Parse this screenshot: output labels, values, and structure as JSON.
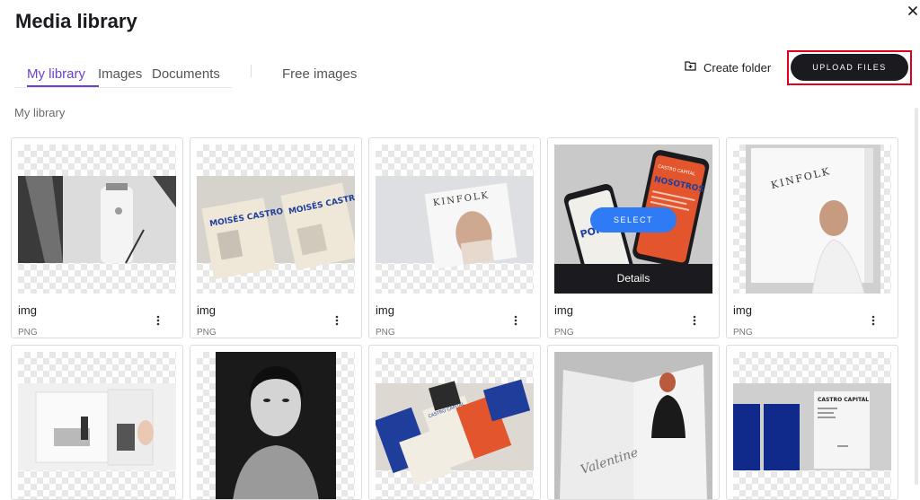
{
  "modal": {
    "title": "Media library"
  },
  "tabs": [
    {
      "label": "My library",
      "active": true
    },
    {
      "label": "Images",
      "active": false
    },
    {
      "label": "Documents",
      "active": false
    }
  ],
  "free_images_tab": "Free images",
  "toolbar": {
    "create_folder": "Create folder",
    "upload": "UPLOAD FILES"
  },
  "breadcrumb": "My library",
  "hover_actions": {
    "select": "SELECT",
    "details": "Details"
  },
  "accent_color": "#6b3fd1",
  "files": [
    {
      "name": "img",
      "type": "PNG"
    },
    {
      "name": "img",
      "type": "PNG"
    },
    {
      "name": "img",
      "type": "PNG"
    },
    {
      "name": "img",
      "type": "PNG"
    },
    {
      "name": "img",
      "type": "PNG"
    }
  ],
  "thumbnails": {
    "poster_text": "MOISÉS CASTRO",
    "magazine_text": "KINFOLK",
    "app_brand": "CASTRO CAPITAL",
    "app_headline": "NOSOTROS",
    "app_headline_2": "POR",
    "book_text": "Valentine",
    "doc_brand": "CASTRO CAPITAL"
  }
}
